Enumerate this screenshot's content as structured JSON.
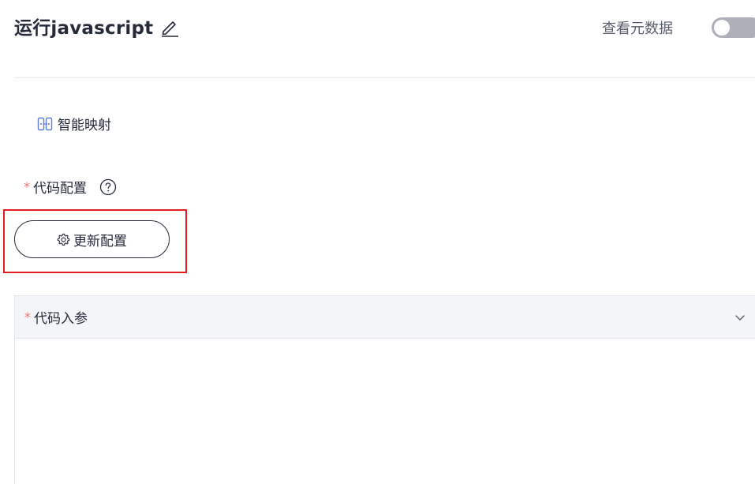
{
  "header": {
    "title": "运行javascript",
    "edit_icon": "pencil-icon",
    "metadata_label": "查看元数据",
    "metadata_toggle_on": false
  },
  "smart_mapping": {
    "icon": "mapping-icon",
    "label": "智能映射"
  },
  "code_config": {
    "required_mark": "*",
    "label": "代码配置",
    "help_icon": "help-circle-icon",
    "update_button": {
      "icon": "gear-icon",
      "label": "更新配置"
    }
  },
  "code_params": {
    "required_mark": "*",
    "label": "代码入参",
    "chevron_icon": "chevron-down-icon"
  },
  "colors": {
    "required": "#f66f6a",
    "highlight_border": "#e02020",
    "toggle_off": "#adb0b8",
    "accent": "#5e7ce0"
  }
}
